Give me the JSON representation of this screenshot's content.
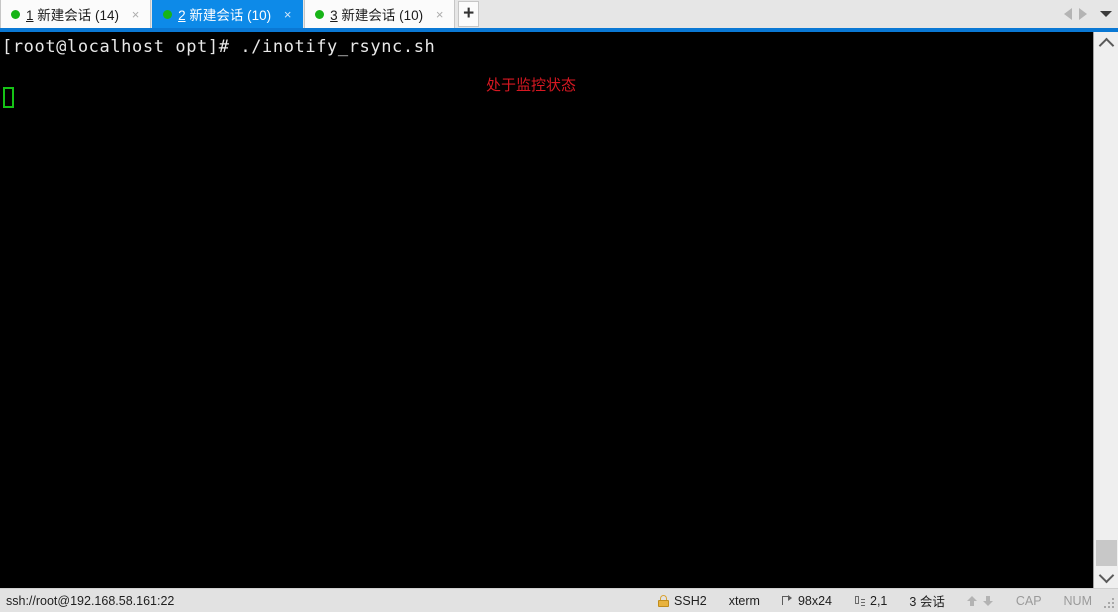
{
  "tabbar": {
    "tabs": [
      {
        "index": "1",
        "title": "新建会话",
        "count": "(14)",
        "close": "×",
        "status_icon": "green-dot",
        "active": false
      },
      {
        "index": "2",
        "title": "新建会话",
        "count": "(10)",
        "close": "×",
        "status_icon": "green-dot",
        "active": true
      },
      {
        "index": "3",
        "title": "新建会话",
        "count": "(10)",
        "close": "×",
        "status_icon": "green-dot",
        "active": false
      }
    ],
    "add_tab_label": "+",
    "nav_prev_icon": "triangle-left-icon",
    "nav_next_icon": "triangle-right-icon",
    "nav_menu_icon": "chevron-down-icon"
  },
  "terminal": {
    "lines": [
      "[root@localhost opt]# ./inotify_rsync.sh"
    ],
    "cursor": {
      "row": 2,
      "col": 1,
      "style": "hollow-green-box"
    },
    "annotation": "处于监控状态",
    "annotation_color": "#d71822",
    "background": "#000000",
    "foreground": "#e8e8e8"
  },
  "scrollbar": {
    "up_icon": "chevron-up-icon",
    "down_icon": "chevron-down-icon",
    "thumb_position": "bottom"
  },
  "statusbar": {
    "connection": "ssh://root@192.168.58.161:22",
    "protocol_icon": "lock-icon",
    "protocol": "SSH2",
    "emulation": "xterm",
    "size_icon": "terminal-size-icon",
    "size": "98x24",
    "caret_icon": "cursor-position-icon",
    "caret": "2,1",
    "sessions": "3 会话",
    "upload_icon": "arrow-up-icon",
    "download_icon": "arrow-down-icon",
    "caps_lock": "CAP",
    "num_lock": "NUM",
    "resize_grip_icon": "resize-grip-icon"
  }
}
